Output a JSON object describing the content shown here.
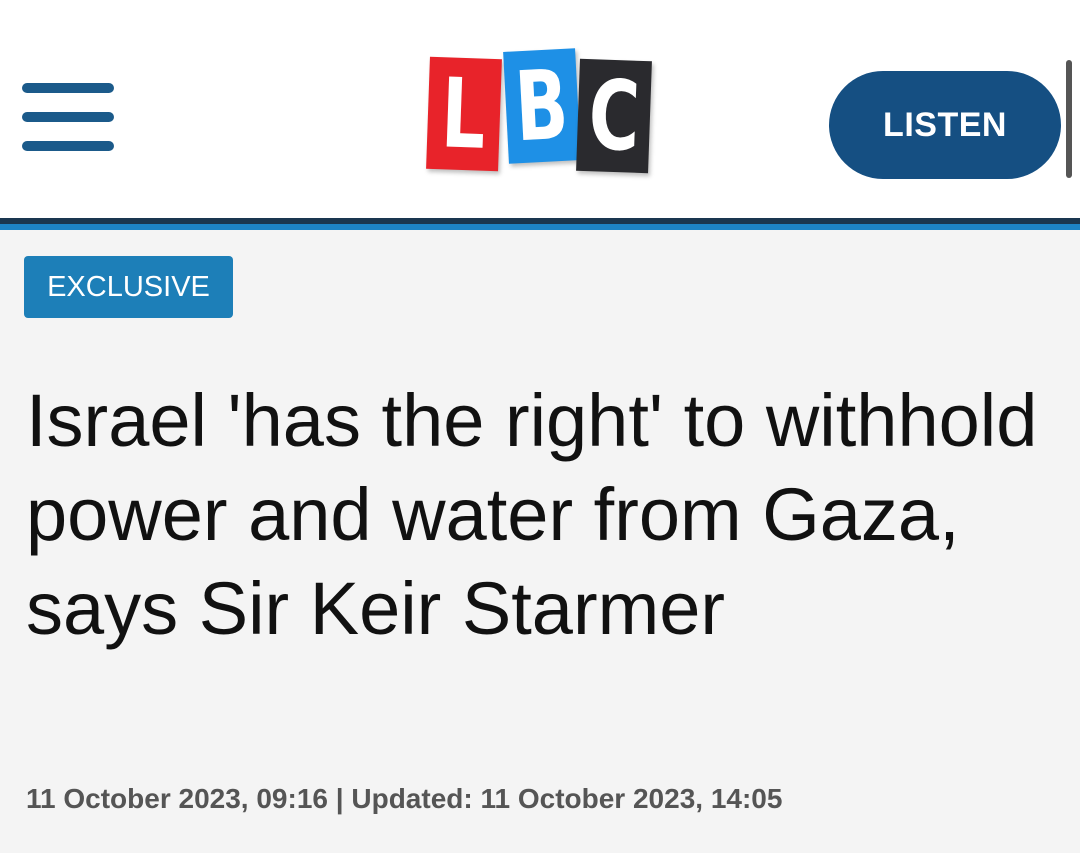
{
  "header": {
    "menu_icon": "hamburger-menu-icon",
    "logo": {
      "letters": [
        "L",
        "B",
        "C"
      ],
      "colors": [
        "#e8232a",
        "#1e90e6",
        "#2a2a2e"
      ]
    },
    "listen_label": "LISTEN",
    "accent_color": "#154f82"
  },
  "article": {
    "badge": "EXCLUSIVE",
    "badge_color": "#1d7fb8",
    "headline": "Israel 'has the right' to withhold power and water from Gaza, says Sir Keir Starmer",
    "dateline": "11 October 2023, 09:16 | Updated: 11 October 2023, 14:05"
  }
}
